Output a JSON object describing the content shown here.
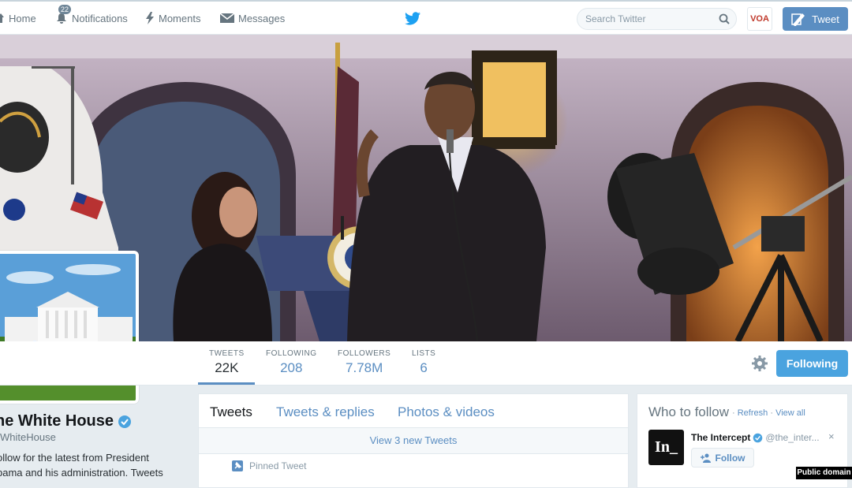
{
  "nav": {
    "home": "Home",
    "notifications": "Notifications",
    "notifications_count": "22",
    "moments": "Moments",
    "messages": "Messages"
  },
  "search": {
    "placeholder": "Search Twitter"
  },
  "account_avatar": "VOA",
  "tweet_button": "Tweet",
  "stats": [
    {
      "label": "TWEETS",
      "value": "22K"
    },
    {
      "label": "FOLLOWING",
      "value": "208"
    },
    {
      "label": "FOLLOWERS",
      "value": "7.78M"
    },
    {
      "label": "LISTS",
      "value": "6"
    }
  ],
  "following_button": "Following",
  "profile": {
    "name": "he White House",
    "handle": "WhiteHouse",
    "bio_line1": "ollow for the latest from President",
    "bio_line2": "bama and his administration. Tweets"
  },
  "timeline": {
    "tabs": [
      "Tweets",
      "Tweets & replies",
      "Photos & videos"
    ],
    "new_tweets": "View 3 new Tweets",
    "pinned_label": "Pinned Tweet"
  },
  "who_to_follow": {
    "title": "Who to follow",
    "refresh": "Refresh",
    "view_all": "View all",
    "separator": "·",
    "suggestion": {
      "avatar_text": "In_",
      "name": "The Intercept",
      "handle": "@the_inter...",
      "follow_label": "Follow",
      "close": "×"
    }
  },
  "credit": "Public domain",
  "colors": {
    "accent": "#5b8ec2",
    "following_button": "#4aa3df",
    "twitter_blue": "#1da1f2"
  }
}
